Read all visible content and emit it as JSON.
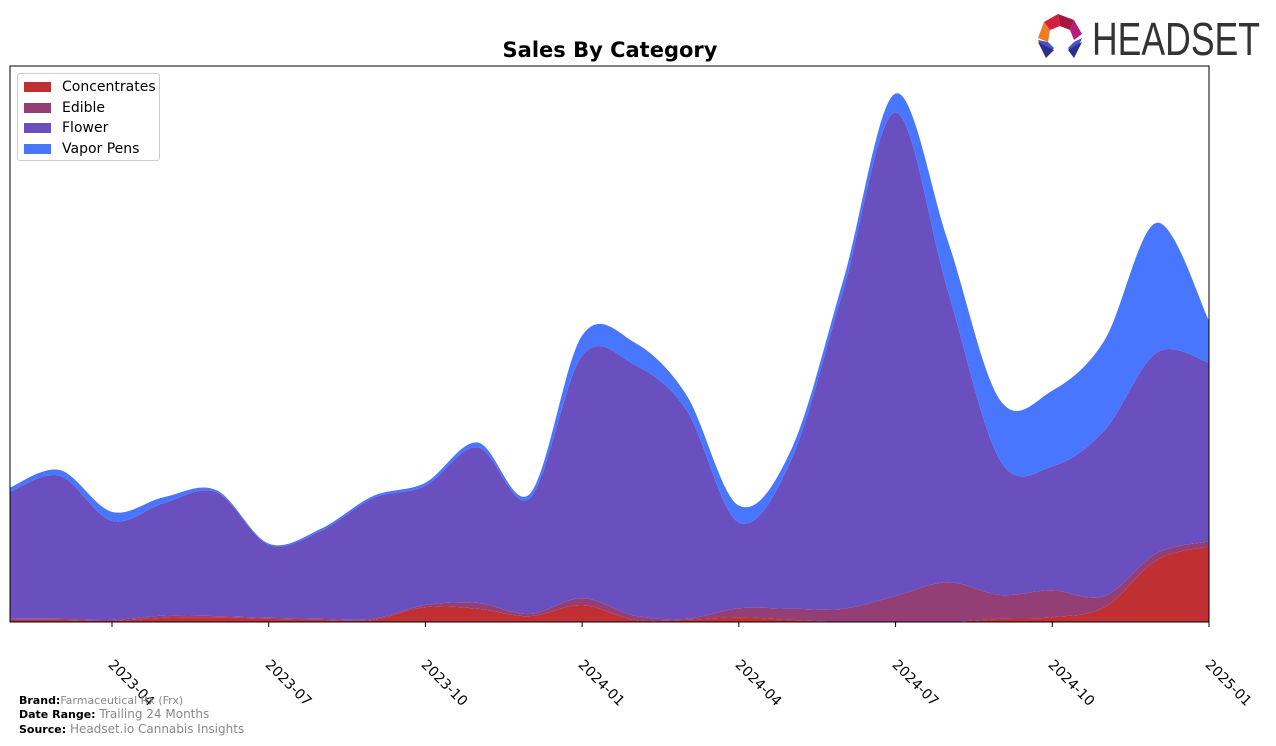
{
  "chart_data": {
    "type": "area",
    "stacked": true,
    "title": "Sales By Category",
    "xlabel": "",
    "ylabel": "",
    "x": [
      "2023-02",
      "2023-03",
      "2023-04",
      "2023-05",
      "2023-06",
      "2023-07",
      "2023-08",
      "2023-09",
      "2023-10",
      "2023-11",
      "2023-12",
      "2024-01",
      "2024-02",
      "2024-03",
      "2024-04",
      "2024-05",
      "2024-06",
      "2024-07",
      "2024-08",
      "2024-09",
      "2024-10",
      "2024-11",
      "2024-12",
      "2025-01"
    ],
    "x_ticks": [
      "2023-04",
      "2023-07",
      "2023-10",
      "2024-01",
      "2024-04",
      "2024-07",
      "2024-10",
      "2025-01"
    ],
    "ylim": [
      0,
      105
    ],
    "grid": false,
    "legend_placement": "top-left",
    "series": [
      {
        "name": "Concentrates",
        "color": "#c03033",
        "values": [
          0.4,
          0.4,
          0.2,
          0.8,
          0.9,
          0.6,
          0.4,
          0.4,
          2.8,
          2.5,
          1.1,
          3.2,
          0.4,
          0.4,
          0.9,
          0.4,
          0,
          0,
          0,
          0.6,
          0.9,
          2.8,
          11.7,
          14.3
        ]
      },
      {
        "name": "Edible",
        "color": "#943e76",
        "values": [
          0.2,
          0.2,
          0.2,
          0.4,
          0.2,
          0.2,
          0.2,
          0.2,
          0.4,
          1.1,
          0.4,
          1.3,
          0.8,
          0.2,
          1.7,
          2.1,
          2.5,
          4.9,
          7.5,
          4.5,
          5.1,
          2.1,
          1.3,
          0.9
        ]
      },
      {
        "name": "Flower",
        "color": "#6a4fbf",
        "values": [
          24.0,
          27.0,
          18.7,
          21.3,
          23.4,
          13.8,
          16.6,
          22.8,
          22.5,
          29.4,
          21.9,
          45.8,
          47.4,
          39.4,
          16.2,
          28.1,
          60.2,
          91.3,
          55.1,
          25.5,
          23.4,
          31.3,
          37.9,
          33.8
        ]
      },
      {
        "name": "Vapor Pens",
        "color": "#4876ff",
        "values": [
          0.8,
          1.1,
          1.7,
          1.1,
          0.4,
          0.2,
          0.4,
          0.4,
          0.6,
          0.9,
          0.8,
          3.8,
          4.2,
          2.8,
          3.2,
          1.9,
          1.9,
          3.6,
          9.4,
          11.3,
          14.3,
          17.0,
          24.5,
          7.9
        ]
      }
    ]
  },
  "footer": {
    "brand_label": "Brand:",
    "brand_value": "Farmaceutical Rx (Frx)",
    "date_label": "Date Range:",
    "date_value": "Trailing 24 Months",
    "source_label": "Source:",
    "source_value": "Headset.io Cannabis Insights"
  },
  "logo": {
    "text": "HEADSET"
  }
}
